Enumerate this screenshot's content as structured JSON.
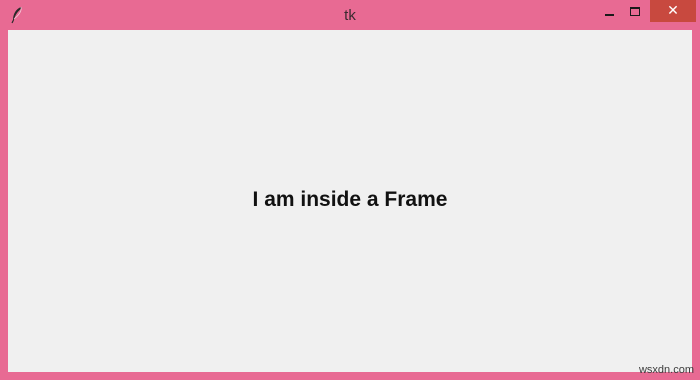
{
  "window": {
    "title": "tk",
    "border_color": "#e86a93",
    "client_background": "#f0f0f0",
    "close_button_color": "#c8493f",
    "app_icon": "tk-feather-icon",
    "controls": {
      "minimize_icon": "minimize-icon",
      "maximize_icon": "maximize-icon",
      "close_icon": "close-icon",
      "close_glyph": "✕"
    }
  },
  "frame": {
    "label": "I am inside a Frame"
  },
  "watermark": "wsxdn.com"
}
